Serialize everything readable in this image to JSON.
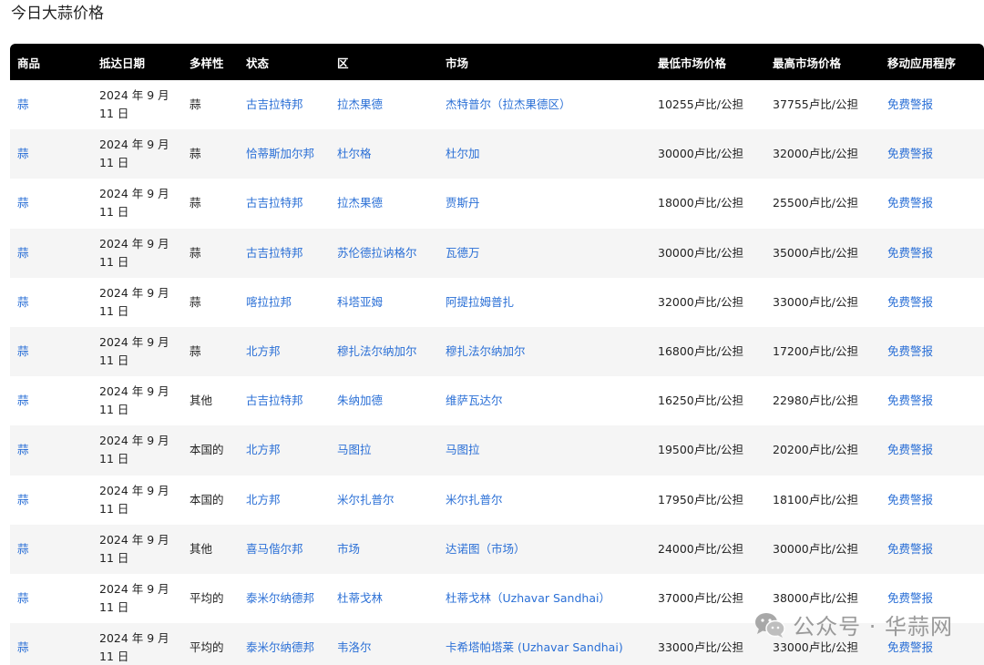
{
  "page": {
    "title": "今日大蒜价格"
  },
  "table": {
    "headers": [
      "商品",
      "抵达日期",
      "多样性",
      "状态",
      "区",
      "市场",
      "最低市场价格",
      "最高市场价格",
      "移动应用程序"
    ],
    "rows": [
      {
        "commodity": "蒜",
        "date_line1": "2024 年 9 月",
        "date_line2": "11 日",
        "variety": "蒜",
        "state": "古吉拉特邦",
        "district": "拉杰果德",
        "market": "杰特普尔（拉杰果德区）",
        "min_price": "10255卢比/公担",
        "max_price": "37755卢比/公担",
        "app": "免费警报"
      },
      {
        "commodity": "蒜",
        "date_line1": "2024 年 9 月",
        "date_line2": "11 日",
        "variety": "蒜",
        "state": "恰蒂斯加尔邦",
        "district": "杜尔格",
        "market": "杜尔加",
        "min_price": "30000卢比/公担",
        "max_price": "32000卢比/公担",
        "app": "免费警报"
      },
      {
        "commodity": "蒜",
        "date_line1": "2024 年 9 月",
        "date_line2": "11 日",
        "variety": "蒜",
        "state": "古吉拉特邦",
        "district": "拉杰果德",
        "market": "贾斯丹",
        "min_price": "18000卢比/公担",
        "max_price": "25500卢比/公担",
        "app": "免费警报"
      },
      {
        "commodity": "蒜",
        "date_line1": "2024 年 9 月",
        "date_line2": "11 日",
        "variety": "蒜",
        "state": "古吉拉特邦",
        "district": "苏伦德拉讷格尔",
        "market": "瓦德万",
        "min_price": "30000卢比/公担",
        "max_price": "35000卢比/公担",
        "app": "免费警报"
      },
      {
        "commodity": "蒜",
        "date_line1": "2024 年 9 月",
        "date_line2": "11 日",
        "variety": "蒜",
        "state": "喀拉拉邦",
        "district": "科塔亚姆",
        "market": "阿提拉姆普扎",
        "min_price": "32000卢比/公担",
        "max_price": "33000卢比/公担",
        "app": "免费警报"
      },
      {
        "commodity": "蒜",
        "date_line1": "2024 年 9 月",
        "date_line2": "11 日",
        "variety": "蒜",
        "state": "北方邦",
        "district": "穆扎法尔纳加尔",
        "market": "穆扎法尔纳加尔",
        "min_price": "16800卢比/公担",
        "max_price": "17200卢比/公担",
        "app": "免费警报"
      },
      {
        "commodity": "蒜",
        "date_line1": "2024 年 9 月",
        "date_line2": "11 日",
        "variety": "其他",
        "state": "古吉拉特邦",
        "district": "朱纳加德",
        "market": "维萨瓦达尔",
        "min_price": "16250卢比/公担",
        "max_price": "22980卢比/公担",
        "app": "免费警报"
      },
      {
        "commodity": "蒜",
        "date_line1": "2024 年 9 月",
        "date_line2": "11 日",
        "variety": "本国的",
        "state": "北方邦",
        "district": "马图拉",
        "market": "马图拉",
        "min_price": "19500卢比/公担",
        "max_price": "20200卢比/公担",
        "app": "免费警报"
      },
      {
        "commodity": "蒜",
        "date_line1": "2024 年 9 月",
        "date_line2": "11 日",
        "variety": "本国的",
        "state": "北方邦",
        "district": "米尔扎普尔",
        "market": "米尔扎普尔",
        "min_price": "17950卢比/公担",
        "max_price": "18100卢比/公担",
        "app": "免费警报"
      },
      {
        "commodity": "蒜",
        "date_line1": "2024 年 9 月",
        "date_line2": "11 日",
        "variety": "其他",
        "state": "喜马偕尔邦",
        "district": "市场",
        "market": "达诺图（市场）",
        "min_price": "24000卢比/公担",
        "max_price": "30000卢比/公担",
        "app": "免费警报"
      },
      {
        "commodity": "蒜",
        "date_line1": "2024 年 9 月",
        "date_line2": "11 日",
        "variety": "平均的",
        "state": "泰米尔纳德邦",
        "district": "杜蒂戈林",
        "market": "杜蒂戈林（Uzhavar Sandhai）",
        "min_price": "37000卢比/公担",
        "max_price": "38000卢比/公担",
        "app": "免费警报"
      },
      {
        "commodity": "蒜",
        "date_line1": "2024 年 9 月",
        "date_line2": "11 日",
        "variety": "平均的",
        "state": "泰米尔纳德邦",
        "district": "韦洛尔",
        "market": "卡希塔帕塔莱 (Uzhavar Sandhai)",
        "min_price": "33000卢比/公担",
        "max_price": "33000卢比/公担",
        "app": "免费警报"
      }
    ]
  },
  "watermark": {
    "text": "公众号 · 华蒜网",
    "icon": "wechat-icon"
  },
  "colors": {
    "header_bg": "#000000",
    "link": "#2a6fd6",
    "row_alt": "#f5f5f5"
  }
}
